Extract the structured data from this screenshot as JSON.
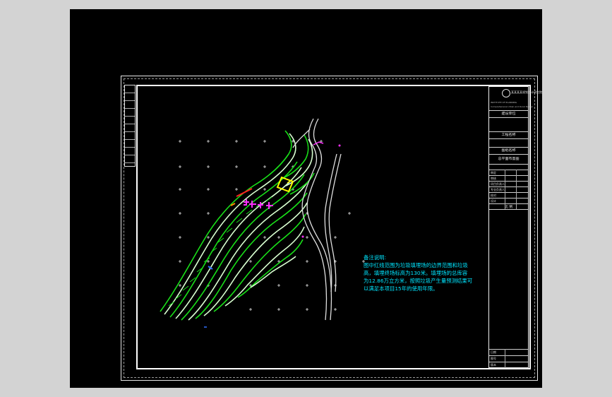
{
  "notes": {
    "heading": "备注说明:",
    "lines": [
      "图中红线范围为垃圾填埋场的边界范围和垃圾",
      "高，填埋终场标高为130米。填埋场的总库容",
      "为12.86万立方米，按照垃圾产生量预测结果可",
      "以满足本项目15年的使用年限。"
    ]
  },
  "title_block": {
    "company": "某某某某规划设计研究院",
    "company_en_1": "INSTITUTE OF PLANNING",
    "company_en_2": "Comprehensive Urban and Rural Design",
    "project_label": "建设单位",
    "project_name_label": "工程名称",
    "drawing_name_label": "图纸名称",
    "drawing_name": "总平面布置图",
    "rows": [
      "审定",
      "审核",
      "项目负责人",
      "专业负责人",
      "校对",
      "设计"
    ],
    "scale_label": "比 例",
    "bottom_rows": [
      "日期",
      "图号",
      "版本"
    ]
  },
  "colors": {
    "background": "#000000",
    "contour": "#19e019",
    "contour_light": "#d8ffd0",
    "road": "#e0e0e0",
    "boundary_red": "#ff2020",
    "label_magenta": "#ff30ff",
    "yellow": "#ffff00",
    "cyan": "#00e5ff"
  }
}
